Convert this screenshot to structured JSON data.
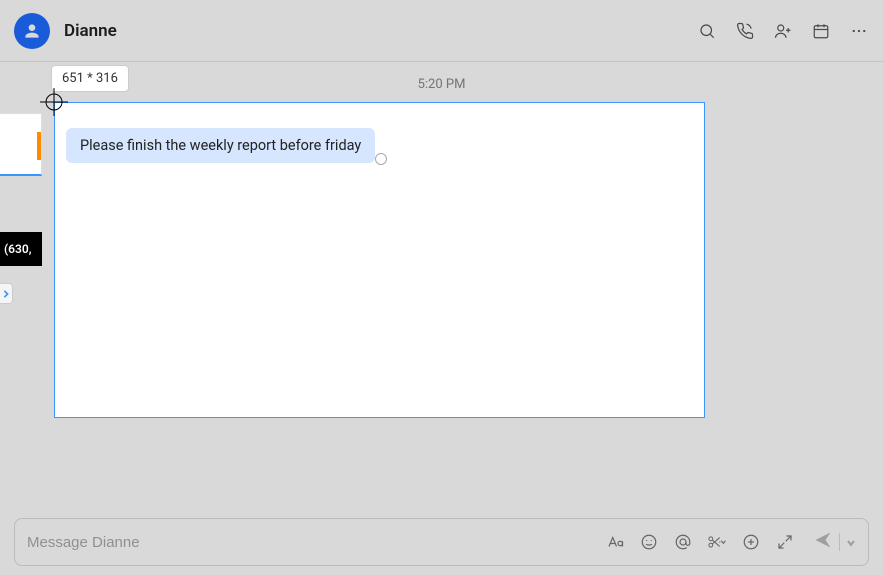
{
  "header": {
    "contact_name": "Dianne"
  },
  "body": {
    "timestamp": "5:20 PM",
    "message": "Please finish the weekly report before friday"
  },
  "snip": {
    "dimensions_label": "651 * 316",
    "coord_label": "(630,"
  },
  "composer": {
    "placeholder": "Message Dianne"
  },
  "icons": {
    "search": "search-icon",
    "call": "call-icon",
    "add_person": "add-person-icon",
    "calendar": "calendar-icon",
    "more": "more-icon",
    "format": "format-icon",
    "emoji": "emoji-icon",
    "mention": "mention-icon",
    "scissors": "scissors-icon",
    "add": "add-icon",
    "expand": "expand-icon",
    "send": "send-icon",
    "chevron": "chevron-right-icon"
  }
}
